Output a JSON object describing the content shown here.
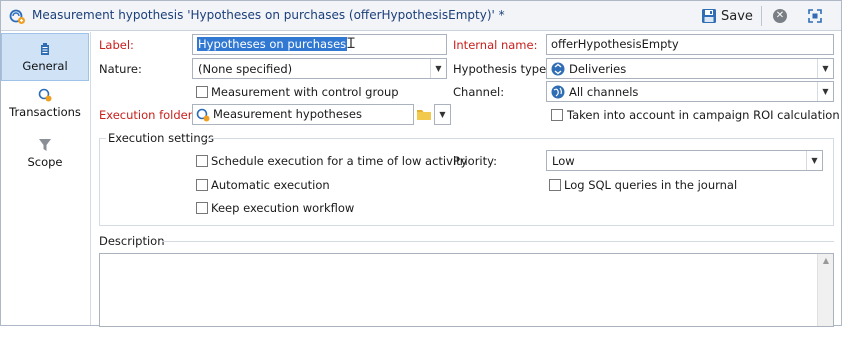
{
  "window": {
    "title": "Measurement hypothesis 'Hypotheses on purchases (offerHypothesisEmpty)' *",
    "save_label": "Save"
  },
  "sidebar": {
    "items": [
      {
        "label": "General",
        "icon": "gear-icon",
        "active": true
      },
      {
        "label": "Transactions",
        "icon": "transactions-icon",
        "active": false
      },
      {
        "label": "Scope",
        "icon": "funnel-icon",
        "active": false
      }
    ]
  },
  "form": {
    "label_label": "Label:",
    "label_value": "Hypotheses on purchases",
    "internal_name_label": "Internal name:",
    "internal_name_value": "offerHypothesisEmpty",
    "nature_label": "Nature:",
    "nature_value": "(None specified)",
    "hypothesis_type_label": "Hypothesis type:",
    "hypothesis_type_value": "Deliveries",
    "control_group_label": "Measurement with control group",
    "channel_label": "Channel:",
    "channel_value": "All channels",
    "execution_folder_label": "Execution folder:",
    "execution_folder_value": "Measurement hypotheses",
    "roi_label": "Taken into account in campaign ROI calculation"
  },
  "execution_settings": {
    "title": "Execution settings",
    "schedule_label": "Schedule execution for a time of low activity",
    "priority_label": "Priority:",
    "priority_value": "Low",
    "automatic_label": "Automatic execution",
    "log_sql_label": "Log SQL queries in the journal",
    "keep_workflow_label": "Keep execution workflow"
  },
  "description": {
    "title": "Description",
    "value": ""
  },
  "colors": {
    "required": "#c8201c",
    "selection": "#3078d2",
    "title_text": "#1b3f7a",
    "sidebar_active": "#cfe2f6"
  }
}
